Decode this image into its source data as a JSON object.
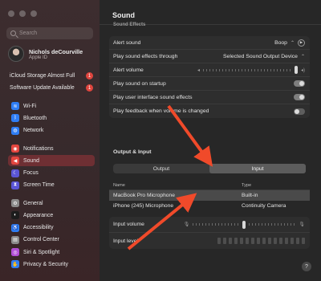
{
  "search": {
    "placeholder": "Search"
  },
  "account": {
    "name": "Nichols deCourville",
    "subtitle": "Apple ID"
  },
  "alerts": [
    {
      "label": "iCloud Storage Almost Full",
      "badge": "1"
    },
    {
      "label": "Software Update Available",
      "badge": "1"
    }
  ],
  "sidebar": {
    "groups": [
      [
        {
          "label": "Wi-Fi",
          "icon": "wifi-icon",
          "color": "#2f7ef5",
          "glyph": "≋"
        },
        {
          "label": "Bluetooth",
          "icon": "bluetooth-icon",
          "color": "#2f7ef5",
          "glyph": "ᛒ"
        },
        {
          "label": "Network",
          "icon": "globe-icon",
          "color": "#2f7ef5",
          "glyph": "◍"
        }
      ],
      [
        {
          "label": "Notifications",
          "icon": "bell-icon",
          "color": "#e3463f",
          "glyph": "◉"
        },
        {
          "label": "Sound",
          "icon": "speaker-icon",
          "color": "#e3463f",
          "glyph": "◀",
          "selected": true
        },
        {
          "label": "Focus",
          "icon": "moon-icon",
          "color": "#5b55d6",
          "glyph": "☾"
        },
        {
          "label": "Screen Time",
          "icon": "hourglass-icon",
          "color": "#5b55d6",
          "glyph": "⧗"
        }
      ],
      [
        {
          "label": "General",
          "icon": "gear-icon",
          "color": "#8b8b8b",
          "glyph": "⚙"
        },
        {
          "label": "Appearance",
          "icon": "appearance-icon",
          "color": "#1c1c1c",
          "glyph": "◐"
        },
        {
          "label": "Accessibility",
          "icon": "accessibility-icon",
          "color": "#2f7ef5",
          "glyph": "♿"
        },
        {
          "label": "Control Center",
          "icon": "control-center-icon",
          "color": "#8b8b8b",
          "glyph": "▤"
        },
        {
          "label": "Siri & Spotlight",
          "icon": "siri-icon",
          "color": "#b34fd6",
          "glyph": "◎"
        },
        {
          "label": "Privacy & Security",
          "icon": "hand-icon",
          "color": "#2f7ef5",
          "glyph": "✋"
        }
      ]
    ]
  },
  "main": {
    "title": "Sound",
    "section_effects": "Sound Effects",
    "effects": {
      "alert_sound_label": "Alert sound",
      "alert_sound_value": "Boop",
      "play_through_label": "Play sound effects through",
      "play_through_value": "Selected Sound Output Device",
      "alert_volume_label": "Alert volume",
      "alert_volume_level": 0.92,
      "startup_label": "Play sound on startup",
      "startup_on": true,
      "ui_sounds_label": "Play user interface sound effects",
      "ui_sounds_on": true,
      "feedback_label": "Play feedback when volume is changed",
      "feedback_on": false
    },
    "section_io": "Output & Input",
    "tabs": {
      "output": "Output",
      "input": "Input",
      "active": "Input"
    },
    "table": {
      "col_name": "Name",
      "col_type": "Type",
      "rows": [
        {
          "name": "MacBook Pro Microphone",
          "type": "Built-in",
          "selected": true
        },
        {
          "name": "iPhone (245) Microphone",
          "type": "Continuity Camera",
          "selected": false
        }
      ]
    },
    "input_volume_label": "Input volume",
    "input_volume_level": 0.55,
    "input_level_label": "Input level",
    "help": "?"
  },
  "colors": {
    "accent_selected": "#6e2f33",
    "badge": "#e0453e",
    "arrow": "#f04a2a"
  }
}
